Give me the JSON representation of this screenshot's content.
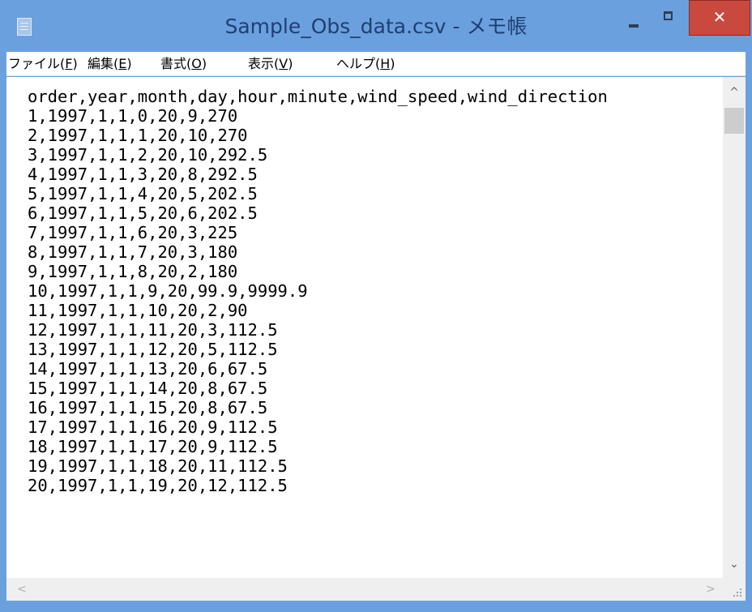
{
  "window": {
    "title": "Sample_Obs_data.csv - メモ帳",
    "icon": "notepad-icon",
    "controls": {
      "minimize": "minimize-icon",
      "maximize": "maximize-icon",
      "close_label": "✕"
    },
    "frame_color": "#6ba0de",
    "close_color": "#c9493f"
  },
  "menu": [
    {
      "label": "ファイル(",
      "key": "F",
      "end": ")"
    },
    {
      "label": "編集(",
      "key": "E",
      "end": ")"
    },
    {
      "label": "書式(",
      "key": "O",
      "end": ")"
    },
    {
      "label": "表示(",
      "key": "V",
      "end": ")"
    },
    {
      "label": "ヘルプ(",
      "key": "H",
      "end": ")"
    }
  ],
  "content": {
    "lines": [
      "order,year,month,day,hour,minute,wind_speed,wind_direction",
      "1,1997,1,1,0,20,9,270",
      "2,1997,1,1,1,20,10,270",
      "3,1997,1,1,2,20,10,292.5",
      "4,1997,1,1,3,20,8,292.5",
      "5,1997,1,1,4,20,5,202.5",
      "6,1997,1,1,5,20,6,202.5",
      "7,1997,1,1,6,20,3,225",
      "8,1997,1,1,7,20,3,180",
      "9,1997,1,1,8,20,2,180",
      "10,1997,1,1,9,20,99.9,9999.9",
      "11,1997,1,1,10,20,2,90",
      "12,1997,1,1,11,20,3,112.5",
      "13,1997,1,1,12,20,5,112.5",
      "14,1997,1,1,13,20,6,67.5",
      "15,1997,1,1,14,20,8,67.5",
      "16,1997,1,1,15,20,8,67.5",
      "17,1997,1,1,16,20,9,112.5",
      "18,1997,1,1,17,20,9,112.5",
      "19,1997,1,1,18,20,11,112.5",
      "20,1997,1,1,19,20,12,112.5"
    ]
  },
  "scrollbars": {
    "up": "^",
    "down": "⌄",
    "left": "<",
    "right": ">"
  }
}
